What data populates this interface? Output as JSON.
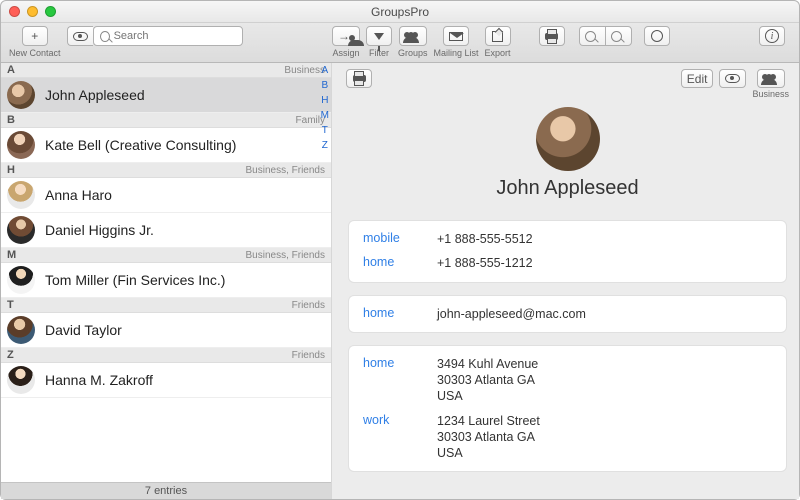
{
  "window": {
    "title": "GroupsPro"
  },
  "toolbar": {
    "newContact": "New Contact",
    "searchPlaceholder": "Search",
    "assign": "Assign",
    "filter": "Filter",
    "groups": "Groups",
    "mailingList": "Mailing List",
    "export": "Export",
    "edit": "Edit",
    "business": "Business"
  },
  "indexLetters": [
    "A",
    "B",
    "H",
    "M",
    "T",
    "Z"
  ],
  "sections": [
    {
      "letter": "A",
      "tag": "Business",
      "rows": [
        {
          "name": "John Appleseed",
          "selected": true,
          "avatar": "av1"
        }
      ]
    },
    {
      "letter": "B",
      "tag": "Family",
      "rows": [
        {
          "name": "Kate Bell (Creative Consulting)",
          "avatar": "av2"
        }
      ]
    },
    {
      "letter": "H",
      "tag": "Business, Friends",
      "rows": [
        {
          "name": "Anna Haro",
          "avatar": "av3"
        },
        {
          "name": "Daniel Higgins Jr.",
          "avatar": "av4"
        }
      ]
    },
    {
      "letter": "M",
      "tag": "Business, Friends",
      "rows": [
        {
          "name": "Tom Miller (Fin Services Inc.)",
          "avatar": "av5"
        }
      ]
    },
    {
      "letter": "T",
      "tag": "Friends",
      "rows": [
        {
          "name": "David Taylor",
          "avatar": "av6"
        }
      ]
    },
    {
      "letter": "Z",
      "tag": "Friends",
      "rows": [
        {
          "name": "Hanna M. Zakroff",
          "avatar": "av7"
        }
      ]
    }
  ],
  "footerCount": "7 entries",
  "detail": {
    "name": "John Appleseed",
    "phones": [
      {
        "label": "mobile",
        "value": "+1 888-555-5512"
      },
      {
        "label": "home",
        "value": "+1 888-555-1212"
      }
    ],
    "emails": [
      {
        "label": "home",
        "value": "john-appleseed@mac.com"
      }
    ],
    "addresses": [
      {
        "label": "home",
        "value": "3494 Kuhl Avenue\n30303 Atlanta GA\nUSA"
      },
      {
        "label": "work",
        "value": "1234 Laurel Street\n30303 Atlanta GA\nUSA"
      }
    ]
  }
}
